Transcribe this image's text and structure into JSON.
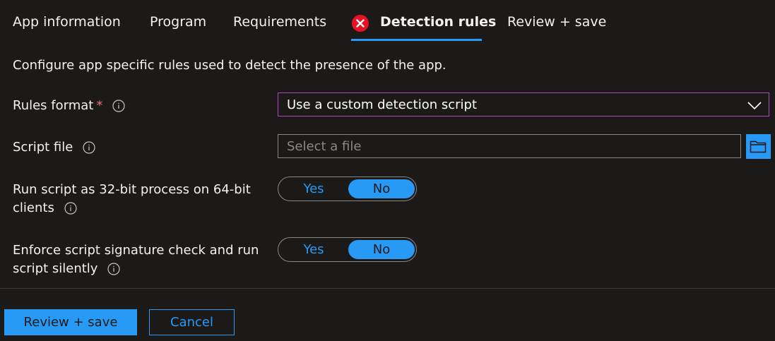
{
  "tabs": {
    "app_information": "App information",
    "program": "Program",
    "requirements": "Requirements",
    "detection_rules": "Detection rules",
    "review_save": "Review + save",
    "active": "Detection rules",
    "error_icon": "error-x-circle"
  },
  "description": "Configure app specific rules used to detect the presence of the app.",
  "rules_format": {
    "label": "Rules format",
    "required_marker": "*",
    "value": "Use a custom detection script"
  },
  "script_file": {
    "label": "Script file",
    "placeholder": "Select a file",
    "browse_icon": "folder-icon"
  },
  "run_32bit": {
    "label_line1": "Run script as 32-bit process on 64-bit",
    "label_line2": "clients",
    "yes": "Yes",
    "no": "No",
    "selected": "No"
  },
  "enforce_signature": {
    "label_line1": "Enforce script signature check and run",
    "label_line2": "script silently",
    "yes": "Yes",
    "no": "No",
    "selected": "No"
  },
  "footer": {
    "review_save": "Review + save",
    "cancel": "Cancel"
  },
  "colors": {
    "background": "#1b1a19",
    "accent": "#2899f5",
    "error": "#e81123",
    "focus_border": "#b146c2"
  }
}
